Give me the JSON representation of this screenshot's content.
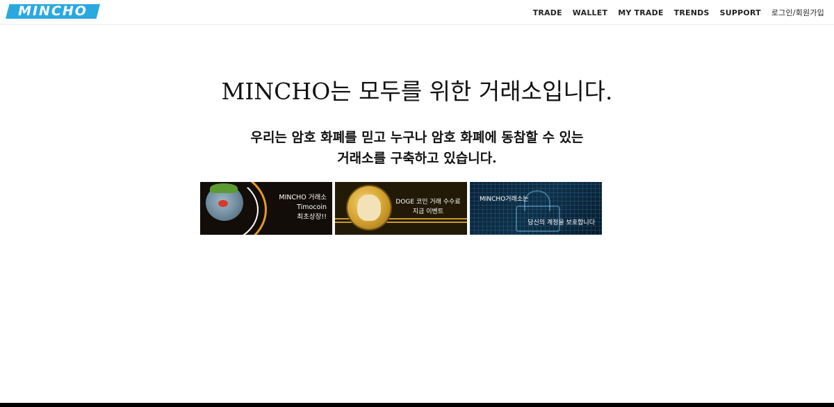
{
  "header": {
    "logo_text": "MINCHO",
    "nav": [
      {
        "label": "TRADE"
      },
      {
        "label": "WALLET"
      },
      {
        "label": "MY TRADE"
      },
      {
        "label": "TRENDS"
      },
      {
        "label": "SUPPORT"
      },
      {
        "label": "로그인/회원가입"
      }
    ]
  },
  "hero": {
    "title": "MINCHO는 모두를 위한 거래소입니다.",
    "subtitle_line1": "우리는 암호 화폐를 믿고 누구나 암호 화폐에 동참할 수 있는",
    "subtitle_line2": "거래소를 구축하고 있습니다."
  },
  "banners": [
    {
      "lines": [
        "MINCHO 거래소",
        "Timocoin",
        "최초상장!!"
      ]
    },
    {
      "lines": [
        "DOGE 코인 거래 수수료",
        "지금 이벤트"
      ]
    },
    {
      "lines": [
        "MINCHO거래소는",
        "당신의 계정을 보호합니다"
      ]
    }
  ],
  "colors": {
    "brand": "#2aa9e0",
    "accent_orange": "#e49a22",
    "text": "#111111"
  }
}
